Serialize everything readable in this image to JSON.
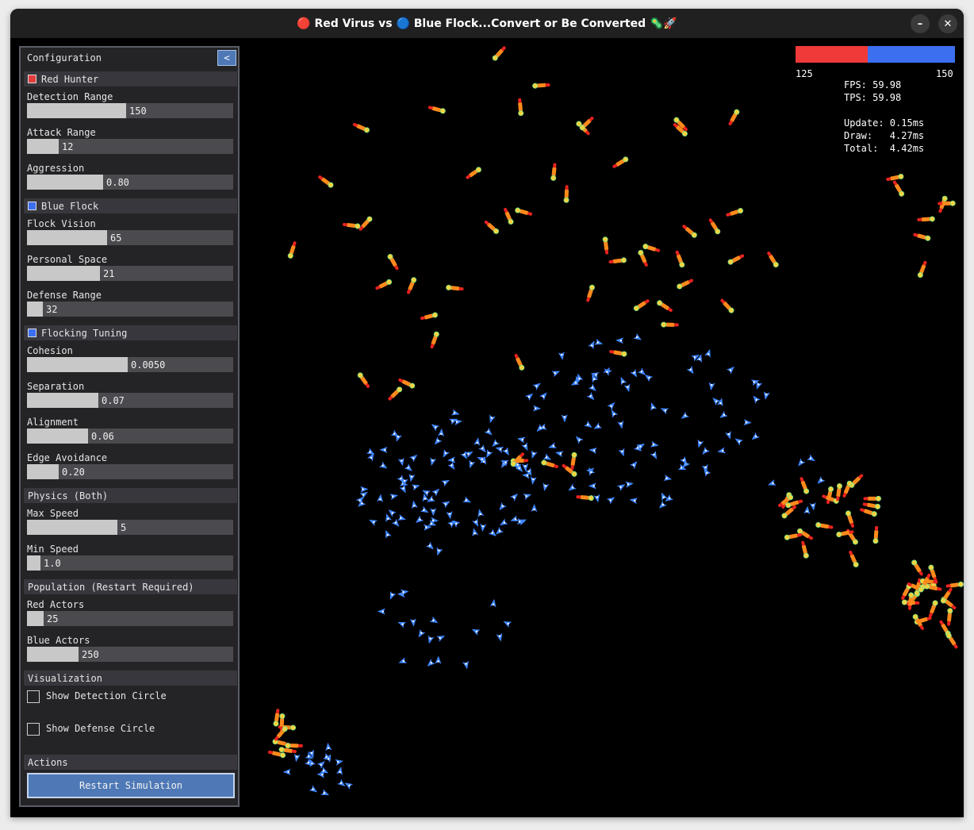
{
  "window": {
    "title": "🔴 Red Virus vs 🔵 Blue Flock...Convert or Be Converted 🦠🚀",
    "minimize_icon": "minimize-icon",
    "close_icon": "close-icon"
  },
  "config": {
    "title": "Configuration",
    "collapse_label": "<",
    "sections": {
      "red_hunter": {
        "title": "Red Hunter",
        "color": "#e53b3b"
      },
      "blue_flock": {
        "title": "Blue Flock",
        "color": "#3c6ef0"
      },
      "flocking_tuning": {
        "title": "Flocking Tuning",
        "color": "#3c6ef0"
      },
      "physics": {
        "title": "Physics (Both)"
      },
      "population": {
        "title": "Population (Restart Required)"
      },
      "visualization": {
        "title": "Visualization"
      },
      "actions": {
        "title": "Actions"
      }
    },
    "sliders": {
      "detection_range": {
        "label": "Detection Range",
        "value": "150",
        "fraction": 0.48
      },
      "attack_range": {
        "label": "Attack Range",
        "value": "12",
        "fraction": 0.155
      },
      "aggression": {
        "label": "Aggression",
        "value": "0.80",
        "fraction": 0.37
      },
      "flock_vision": {
        "label": "Flock Vision",
        "value": "65",
        "fraction": 0.39
      },
      "personal_space": {
        "label": "Personal Space",
        "value": "21",
        "fraction": 0.355
      },
      "defense_range": {
        "label": "Defense Range",
        "value": "32",
        "fraction": 0.075
      },
      "cohesion": {
        "label": "Cohesion",
        "value": "0.0050",
        "fraction": 0.49
      },
      "separation": {
        "label": "Separation",
        "value": "0.07",
        "fraction": 0.345
      },
      "alignment": {
        "label": "Alignment",
        "value": "0.06",
        "fraction": 0.295
      },
      "edge_avoidance": {
        "label": "Edge Avoidance",
        "value": "0.20",
        "fraction": 0.155
      },
      "max_speed": {
        "label": "Max Speed",
        "value": "5",
        "fraction": 0.44
      },
      "min_speed": {
        "label": "Min Speed",
        "value": "1.0",
        "fraction": 0.065
      },
      "red_actors": {
        "label": "Red Actors",
        "value": "25",
        "fraction": 0.08
      },
      "blue_actors": {
        "label": "Blue Actors",
        "value": "250",
        "fraction": 0.25
      }
    },
    "checkboxes": {
      "show_detection": {
        "label": "Show Detection Circle",
        "checked": false
      },
      "show_defense": {
        "label": "Show Defense Circle",
        "checked": false
      }
    },
    "restart_label": "Restart Simulation"
  },
  "hud": {
    "red_count": "125",
    "blue_count": "150",
    "red_fraction": 0.455,
    "red_color": "#f03a3a",
    "blue_color": "#3c6ef0",
    "fps": "FPS: 59.98",
    "tps": "TPS: 59.98",
    "update": "Update: 0.15ms",
    "draw": "Draw:   4.27ms",
    "total": "Total:  4.42ms"
  }
}
